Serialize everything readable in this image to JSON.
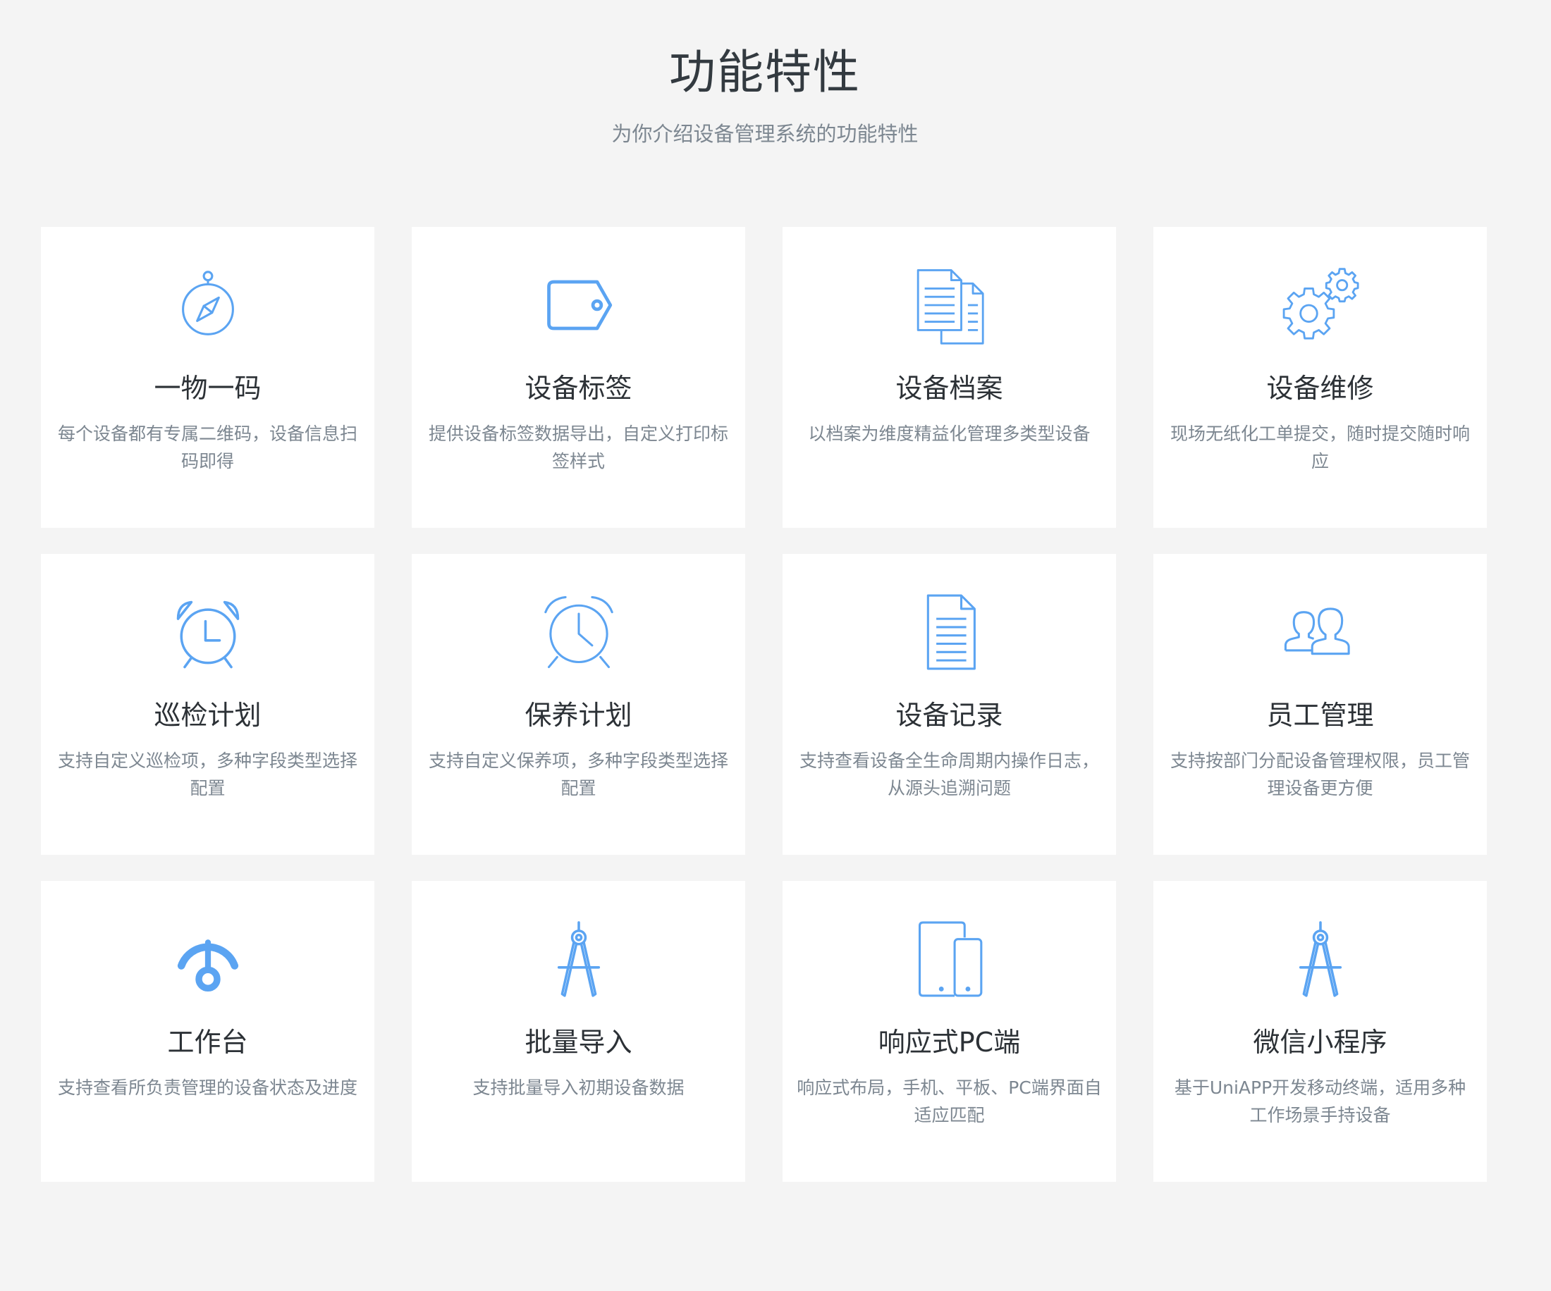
{
  "header": {
    "title": "功能特性",
    "subtitle": "为你介绍设备管理系统的功能特性"
  },
  "accent_color": "#5ba4f2",
  "features": [
    {
      "icon": "compass-icon",
      "title": "一物一码",
      "desc": "每个设备都有专属二维码，设备信息扫码即得"
    },
    {
      "icon": "tag-icon",
      "title": "设备标签",
      "desc": "提供设备标签数据导出，自定义打印标签样式"
    },
    {
      "icon": "documents-icon",
      "title": "设备档案",
      "desc": "以档案为维度精益化管理多类型设备"
    },
    {
      "icon": "gears-icon",
      "title": "设备维修",
      "desc": "现场无纸化工单提交，随时提交随时响应"
    },
    {
      "icon": "alarm-clock-icon",
      "title": "巡检计划",
      "desc": "支持自定义巡检项，多种字段类型选择配置"
    },
    {
      "icon": "alarm-clock-outline-icon",
      "title": "保养计划",
      "desc": "支持自定义保养项，多种字段类型选择配置"
    },
    {
      "icon": "document-icon",
      "title": "设备记录",
      "desc": "支持查看设备全生命周期内操作日志，从源头追溯问题"
    },
    {
      "icon": "users-icon",
      "title": "员工管理",
      "desc": "支持按部门分配设备管理权限，员工管理设备更方便"
    },
    {
      "icon": "dashboard-icon",
      "title": "工作台",
      "desc": "支持查看所负责管理的设备状态及进度"
    },
    {
      "icon": "drafting-compass-icon",
      "title": "批量导入",
      "desc": "支持批量导入初期设备数据"
    },
    {
      "icon": "tablet-phone-icon",
      "title": "响应式PC端",
      "desc": "响应式布局，手机、平板、PC端界面自适应匹配"
    },
    {
      "icon": "drafting-compass-icon",
      "title": "微信小程序",
      "desc": "基于UniAPP开发移动终端，适用多种工作场景手持设备"
    }
  ]
}
